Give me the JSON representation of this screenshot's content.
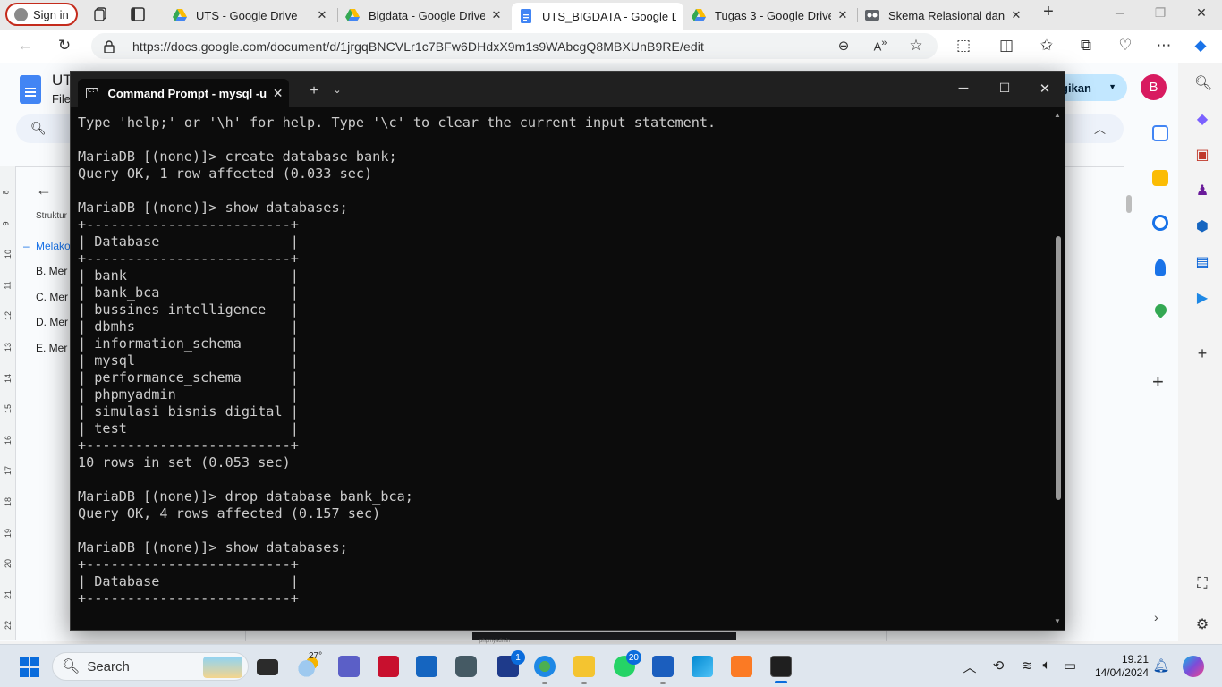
{
  "browser": {
    "signin_label": "Sign in",
    "tabs": [
      {
        "title": "UTS - Google Drive",
        "active": false
      },
      {
        "title": "Bigdata - Google Drive",
        "active": false
      },
      {
        "title": "UTS_BIGDATA - Google D",
        "active": true
      },
      {
        "title": "Tugas 3 - Google Drive",
        "active": false
      },
      {
        "title": "Skema Relasional dan Pe",
        "active": false
      }
    ],
    "url": "https://docs.google.com/document/d/1jrgqBNCVLr1c7BFw6DHdxX9m1s9WAbcgQ8MBXUnB9RE/edit"
  },
  "docs": {
    "title_fragment": "UT",
    "menu_fragment": "File",
    "share_label": "gikan",
    "account_initial": "B",
    "outline_heading": "Struktur",
    "outline_items": [
      {
        "label": "Melako",
        "selected": true
      },
      {
        "label": "B. Mer",
        "selected": false
      },
      {
        "label": "C. Mer",
        "selected": false
      },
      {
        "label": "D. Mer",
        "selected": false
      },
      {
        "label": "E. Mer",
        "selected": false
      }
    ],
    "ruler_numbers": [
      "8",
      "9",
      "10",
      "11",
      "12",
      "13",
      "14",
      "15",
      "16",
      "17",
      "18",
      "19",
      "20",
      "21",
      "22"
    ],
    "bottom_bar_text": "phpmyadmin"
  },
  "cmd": {
    "tab_title": "Command Prompt - mysql  -u",
    "lines": [
      "Type 'help;' or '\\h' for help. Type '\\c' to clear the current input statement.",
      "",
      "MariaDB [(none)]> create database bank;",
      "Query OK, 1 row affected (0.033 sec)",
      "",
      "MariaDB [(none)]> show databases;",
      "+-------------------------+",
      "| Database                |",
      "+-------------------------+",
      "| bank                    |",
      "| bank_bca                |",
      "| bussines intelligence   |",
      "| dbmhs                   |",
      "| information_schema      |",
      "| mysql                   |",
      "| performance_schema      |",
      "| phpmyadmin              |",
      "| simulasi bisnis digital |",
      "| test                    |",
      "+-------------------------+",
      "10 rows in set (0.053 sec)",
      "",
      "MariaDB [(none)]> drop database bank_bca;",
      "Query OK, 4 rows affected (0.157 sec)",
      "",
      "MariaDB [(none)]> show databases;",
      "+-------------------------+",
      "| Database                |",
      "+-------------------------+"
    ]
  },
  "taskbar": {
    "search_label": "Search",
    "weather_temp": "27°",
    "badges": {
      "lens": "1",
      "whatsapp": "20"
    },
    "time": "19.21",
    "date": "14/04/2024"
  },
  "colors": {
    "terminal_bg": "#0c0c0c",
    "terminal_fg": "#cccccc",
    "signin_border": "#c42b1c",
    "docs_blue": "#4285f4",
    "share_bg": "#c2e7ff",
    "taskbar_accent": "#0a6cdc"
  }
}
